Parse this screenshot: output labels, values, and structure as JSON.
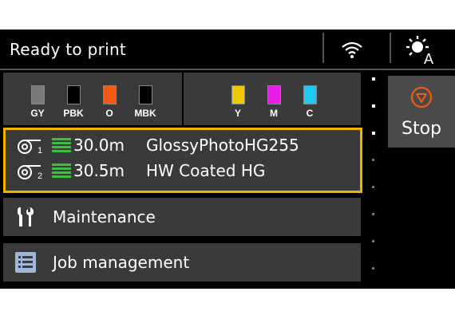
{
  "status": {
    "text": "Ready to print"
  },
  "icons": {
    "wifi": "wifi-icon",
    "display": "display-settings-icon"
  },
  "inks": {
    "group1": [
      {
        "label": "GY",
        "color": "#7a7a7a"
      },
      {
        "label": "PBK",
        "color": "#000000"
      },
      {
        "label": "O",
        "color": "#f05a14"
      },
      {
        "label": "MBK",
        "color": "#000000"
      }
    ],
    "group2": [
      {
        "label": "Y",
        "color": "#f0c800"
      },
      {
        "label": "M",
        "color": "#e81ee8"
      },
      {
        "label": "C",
        "color": "#1ec8f0"
      }
    ]
  },
  "media": {
    "rolls": [
      {
        "roll_number": "1",
        "length": "30.0m",
        "name": "GlossyPhotoHG255"
      },
      {
        "roll_number": "2",
        "length": "30.5m",
        "name": "HW Coated HG"
      }
    ],
    "highlight_color": "#f0b400",
    "remaining_color": "#39c13a"
  },
  "menu": {
    "maintenance": "Maintenance",
    "job_management": "Job management"
  },
  "stop": {
    "label": "Stop",
    "accent": "#f05a14"
  }
}
